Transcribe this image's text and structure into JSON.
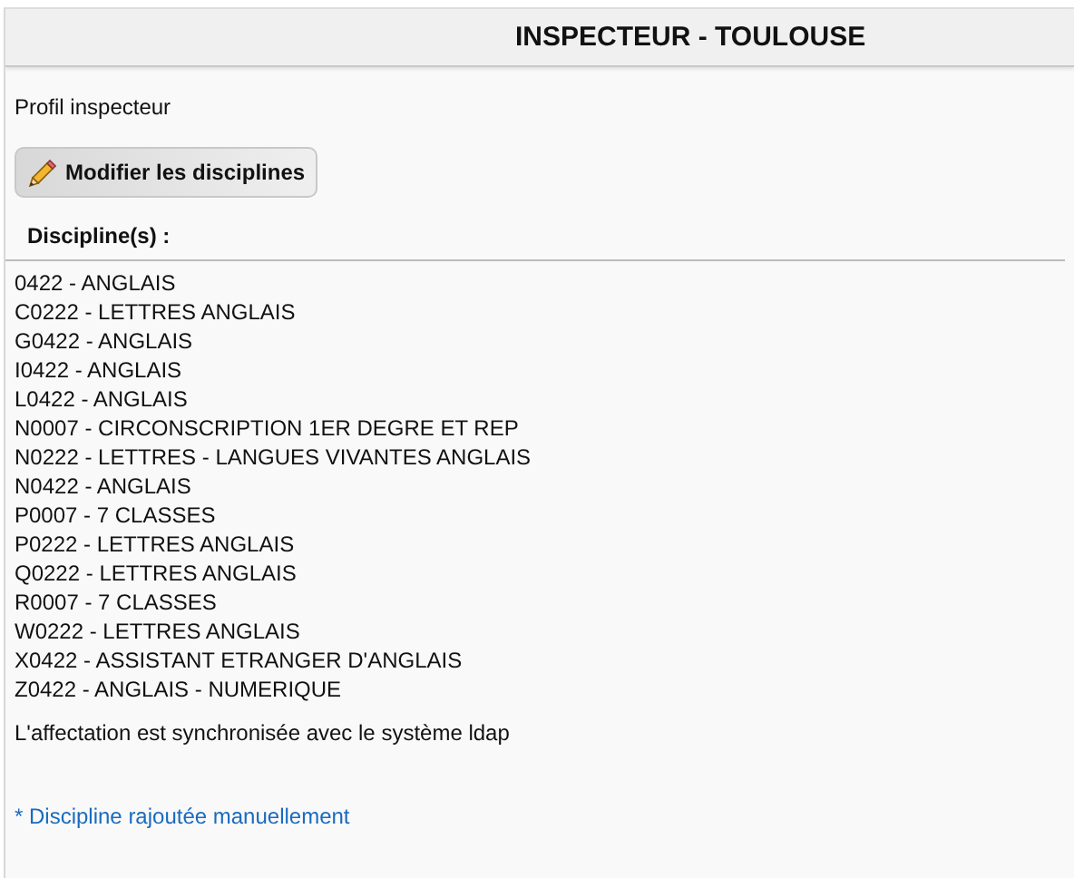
{
  "panel": {
    "title": "INSPECTEUR - TOULOUSE"
  },
  "profile": "Profil inspecteur",
  "edit_button": {
    "label": "Modifier les disciplines"
  },
  "disciplines_heading": "Discipline(s) :",
  "disciplines": [
    "0422 - ANGLAIS",
    "C0222 - LETTRES ANGLAIS",
    "G0422 - ANGLAIS",
    "I0422 - ANGLAIS",
    "L0422 - ANGLAIS",
    "N0007 - CIRCONSCRIPTION 1ER DEGRE ET REP",
    "N0222 - LETTRES - LANGUES VIVANTES ANGLAIS",
    "N0422 - ANGLAIS",
    "P0007 - 7 CLASSES",
    "P0222 - LETTRES ANGLAIS",
    "Q0222 - LETTRES ANGLAIS",
    "R0007 - 7 CLASSES",
    "W0222 - LETTRES ANGLAIS",
    "X0422 - ASSISTANT ETRANGER D'ANGLAIS",
    "Z0422 - ANGLAIS - NUMERIQUE"
  ],
  "sync_note": "L'affectation est synchronisée avec le système ldap",
  "footnote": "* Discipline rajoutée manuellement"
}
